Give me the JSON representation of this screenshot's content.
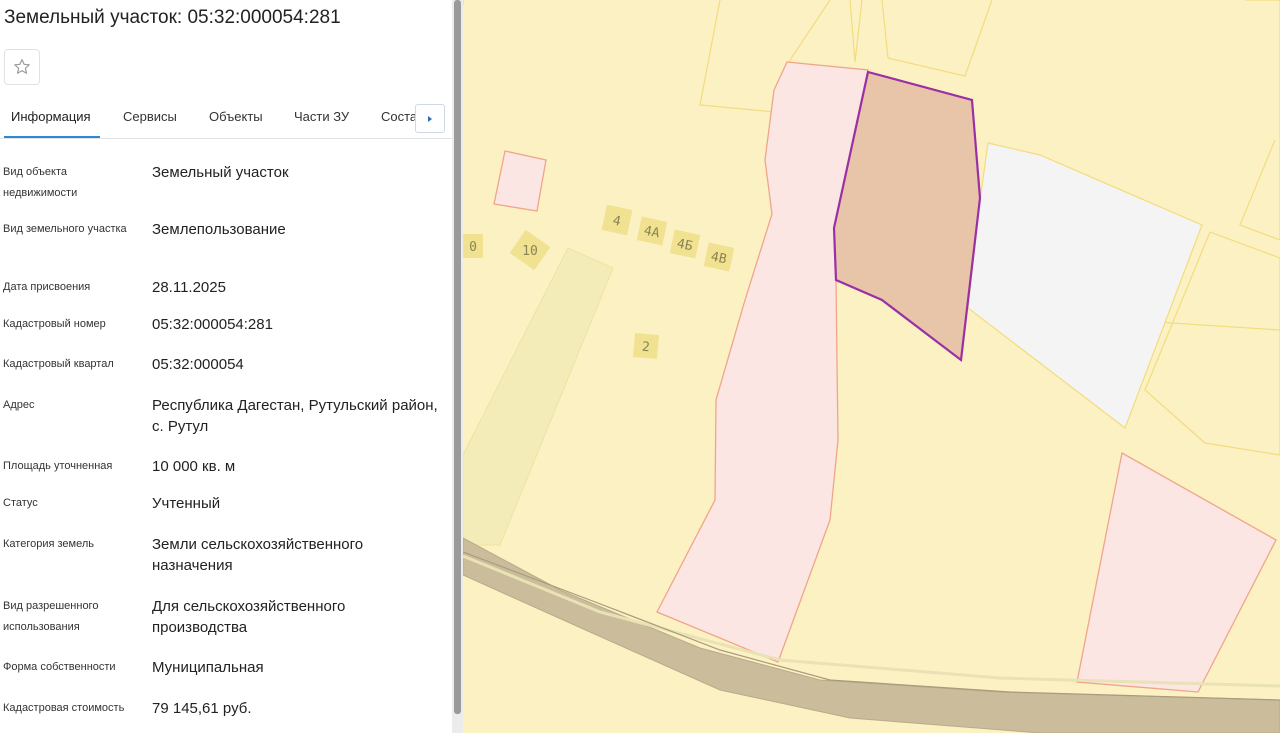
{
  "panel": {
    "title": "Земельный участок: 05:32:000054:281",
    "favorite_icon": "star-outline-icon",
    "tabs": [
      {
        "label": "Информация",
        "active": true
      },
      {
        "label": "Сервисы"
      },
      {
        "label": "Объекты"
      },
      {
        "label": "Части ЗУ"
      },
      {
        "label": "Соста"
      }
    ],
    "tabs_next_icon": "caret-right-icon",
    "fields": [
      {
        "label": "Вид объекта недвижимости",
        "value": "Земельный участок"
      },
      {
        "label": "Вид земельного участка",
        "value": "Землепользование"
      },
      {
        "label": "Дата присвоения",
        "value": "28.11.2025"
      },
      {
        "label": "Кадастровый номер",
        "value": "05:32:000054:281"
      },
      {
        "label": "Кадастровый квартал",
        "value": "05:32:000054"
      },
      {
        "label": "Адрес",
        "value": "Республика Дагестан, Рутульский район, с. Рутул"
      },
      {
        "label": "Площадь уточненная",
        "value": "10 000 кв. м"
      },
      {
        "label": "Статус",
        "value": "Учтенный"
      },
      {
        "label": "Категория земель",
        "value": "Земли сельскохозяйственного назначения"
      },
      {
        "label": "Вид разрешенного использования",
        "value": "Для сельскохозяйственного производства"
      },
      {
        "label": "Форма собственности",
        "value": "Муниципальная"
      },
      {
        "label": "Кадастровая стоимость",
        "value": "79 145,61 руб."
      }
    ]
  },
  "map": {
    "lot_labels": [
      "4",
      "4А",
      "4Б",
      "4В",
      "10",
      "2",
      "0"
    ],
    "colors": {
      "background": "#fbf1c3",
      "selected_fill": "#e8c4a8",
      "selected_stroke": "#9b2fa5",
      "parcel_fill": "#fbe6e3",
      "parcel_stroke": "#f0a58a",
      "road": "#cbbd9b"
    }
  }
}
